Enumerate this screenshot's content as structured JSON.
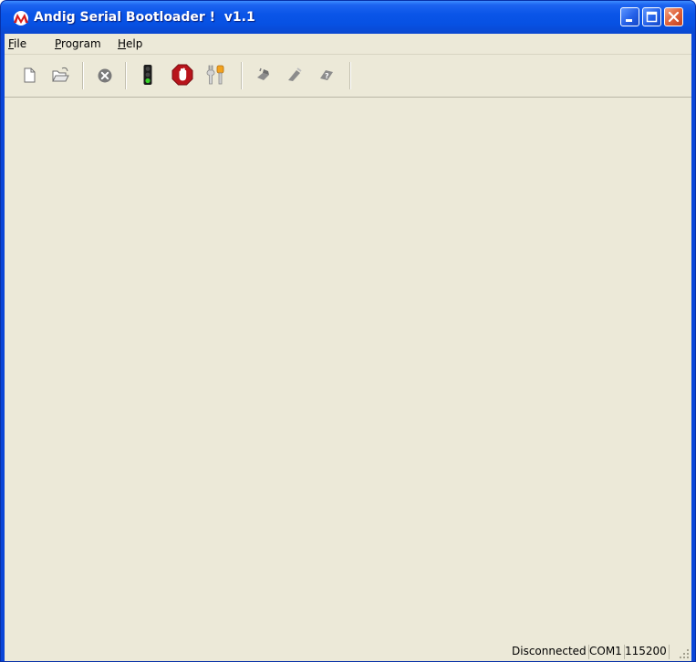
{
  "window": {
    "title": "Andig Serial Bootloader !  v1.1"
  },
  "titlebar_buttons": {
    "minimize": "minimize-icon",
    "maximize": "maximize-icon",
    "close": "close-icon"
  },
  "menu": {
    "items": [
      {
        "label": "File"
      },
      {
        "label": "Program"
      },
      {
        "label": "Help"
      }
    ]
  },
  "toolbar": {
    "groups": [
      [
        "new-file-icon",
        "open-folder-icon"
      ],
      [
        "cancel-icon"
      ],
      [
        "traffic-light-icon",
        "stop-hand-icon",
        "tools-icon"
      ],
      [
        "read-chip-icon",
        "write-chip-icon",
        "verify-chip-icon"
      ]
    ]
  },
  "status": {
    "connection": "Disconnected",
    "port": "COM1",
    "baud": "115200"
  },
  "colors": {
    "titlebar": "#0a55e8",
    "client_bg": "#ece9d8",
    "close_button": "#e0643c",
    "brand_red": "#d81e1e"
  }
}
